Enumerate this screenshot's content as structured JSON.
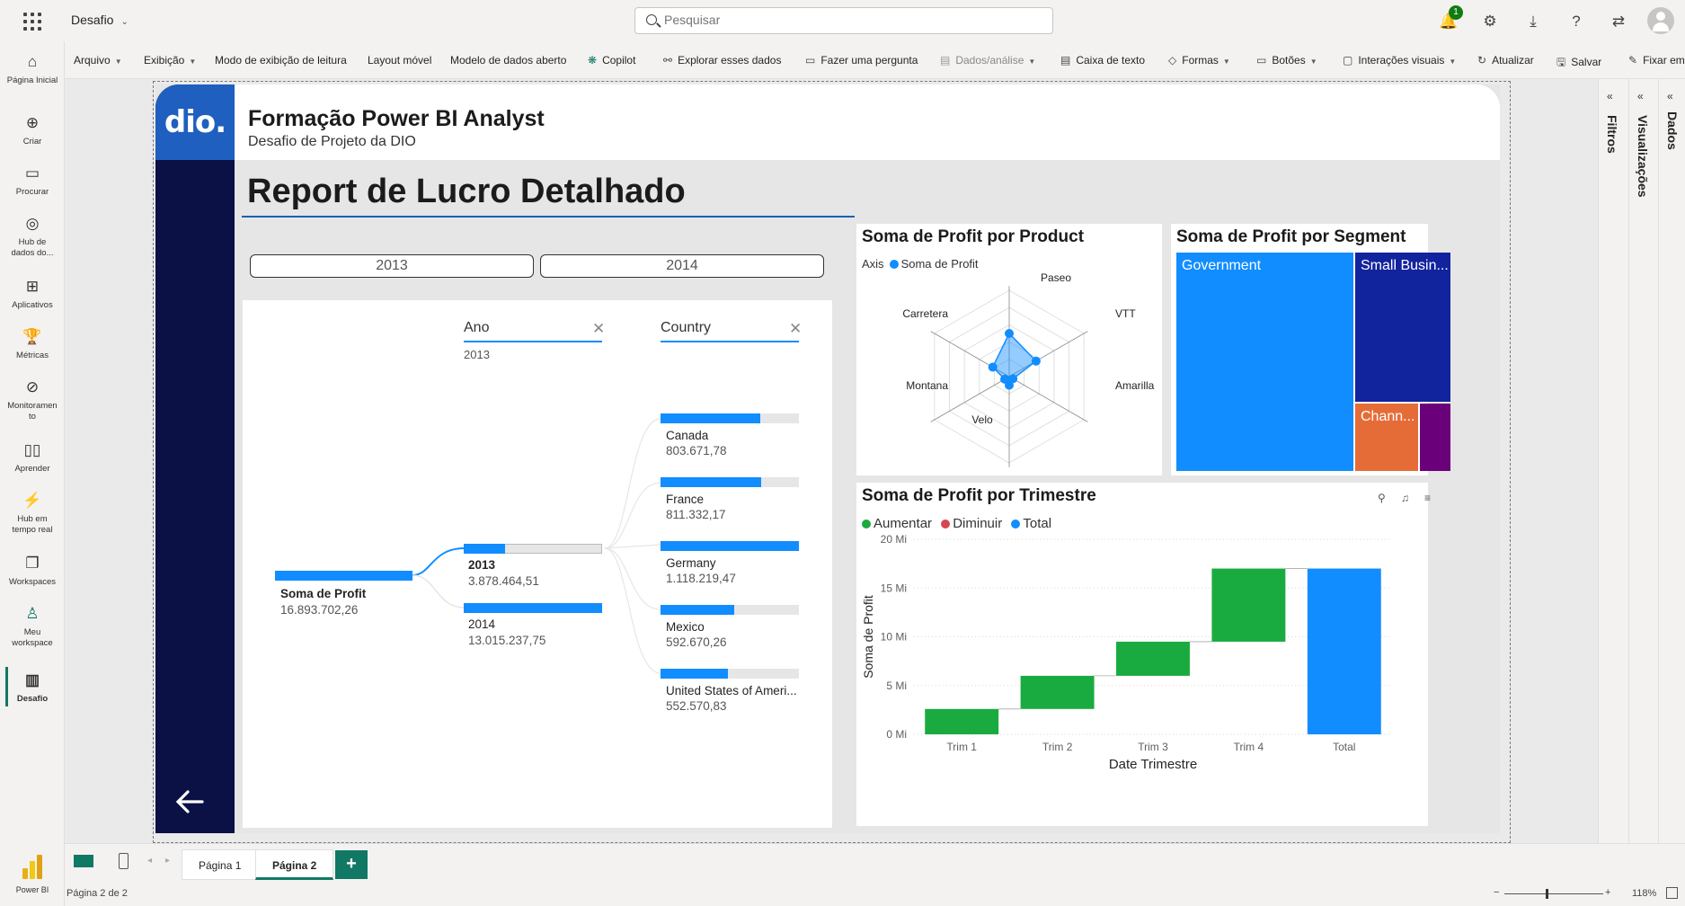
{
  "app": {
    "name": "Desafio"
  },
  "search": {
    "placeholder": "Pesquisar"
  },
  "topbar": {
    "notification_count": "1"
  },
  "nav": [
    {
      "label": "Página Inicial",
      "icon": "home-icon"
    },
    {
      "label": "Criar",
      "icon": "plus-circle-icon"
    },
    {
      "label": "Procurar",
      "icon": "folder-icon"
    },
    {
      "label": "Hub de dados do...",
      "icon": "data-hub-icon"
    },
    {
      "label": "Aplicativos",
      "icon": "apps-icon"
    },
    {
      "label": "Métricas",
      "icon": "trophy-icon"
    },
    {
      "label": "Monitoramento",
      "icon": "monitor-icon"
    },
    {
      "label": "Aprender",
      "icon": "book-icon"
    },
    {
      "label": "Hub em tempo real",
      "icon": "realtime-icon"
    },
    {
      "label": "Workspaces",
      "icon": "workspaces-icon"
    },
    {
      "label": "Meu workspace",
      "icon": "person-icon"
    },
    {
      "label": "Desafio",
      "icon": "report-icon"
    }
  ],
  "brand": {
    "label": "Power BI"
  },
  "ribbon": {
    "arquivo": "Arquivo",
    "exibicao": "Exibição",
    "modo_leitura": "Modo de exibição de leitura",
    "layout_movel": "Layout móvel",
    "modelo_dados": "Modelo de dados aberto",
    "copilot": "Copilot",
    "explorar": "Explorar esses dados",
    "pergunta": "Fazer uma pergunta",
    "dados_analise": "Dados/análise",
    "caixa_texto": "Caixa de texto",
    "formas": "Formas",
    "botoes": "Botões",
    "interacoes": "Interações visuais",
    "atualizar": "Atualizar",
    "salvar": "Salvar",
    "fixar": "Fixar em"
  },
  "panes": {
    "filtros": "Filtros",
    "visualizacoes": "Visualizações",
    "dados": "Dados"
  },
  "report": {
    "logo": "dio.",
    "title": "Formação Power BI Analyst",
    "subtitle": "Desafio de Projeto da DIO",
    "heading": "Report de Lucro Detalhado",
    "slicer": [
      "2013",
      "2014"
    ]
  },
  "decomp": {
    "col_ano": "Ano",
    "col_ano_filter": "2013",
    "col_country": "Country",
    "root": {
      "label": "Soma de Profit",
      "value": "16.893.702,26"
    },
    "years": [
      {
        "label": "2013",
        "value": "3.878.464,51",
        "fraction": 0.3
      },
      {
        "label": "2014",
        "value": "13.015.237,75",
        "fraction": 1.0
      }
    ],
    "countries": [
      {
        "label": "Canada",
        "value": "803.671,78",
        "fraction": 0.72
      },
      {
        "label": "France",
        "value": "811.332,17",
        "fraction": 0.73
      },
      {
        "label": "Germany",
        "value": "1.118.219,47",
        "fraction": 1.0
      },
      {
        "label": "Mexico",
        "value": "592.670,26",
        "fraction": 0.53
      },
      {
        "label": "United States of Ameri...",
        "value": "552.570,83",
        "fraction": 0.49
      }
    ]
  },
  "radar": {
    "title": "Soma de Profit por Product",
    "legend_axis": "Axis",
    "legend_series": "Soma de Profit",
    "axes": [
      "Paseo",
      "VTT",
      "Amarilla",
      "Velo",
      "Montana",
      "Carretera"
    ]
  },
  "treemap": {
    "title": "Soma de Profit por Segment",
    "tiles": [
      {
        "label": "Government",
        "color": "#118dff"
      },
      {
        "label": "Small Busin...",
        "color": "#12239e"
      },
      {
        "label": "Chann...",
        "color": "#e66c37"
      },
      {
        "label": "",
        "color": "#6b007b"
      }
    ]
  },
  "chart_data": {
    "type": "waterfall",
    "title": "Soma de Profit por Trimestre",
    "xlabel": "Date Trimestre",
    "ylabel": "Soma de Profit",
    "categories": [
      "Trim 1",
      "Trim 2",
      "Trim 3",
      "Trim 4",
      "Total"
    ],
    "increments": [
      2.6,
      3.4,
      3.5,
      7.5
    ],
    "total": 17.0,
    "ylim": [
      0,
      20
    ],
    "yticks": [
      "0 Mi",
      "5 Mi",
      "10 Mi",
      "15 Mi",
      "20 Mi"
    ],
    "ytick_values": [
      0,
      5,
      10,
      15,
      20
    ],
    "legend": [
      {
        "name": "Aumentar",
        "color": "#1aab40"
      },
      {
        "name": "Diminuir",
        "color": "#d64550"
      },
      {
        "name": "Total",
        "color": "#118dff"
      }
    ]
  },
  "tabs": {
    "page1": "Página 1",
    "page2": "Página 2"
  },
  "status": {
    "page": "Página 2 de 2",
    "zoom": "118%"
  }
}
